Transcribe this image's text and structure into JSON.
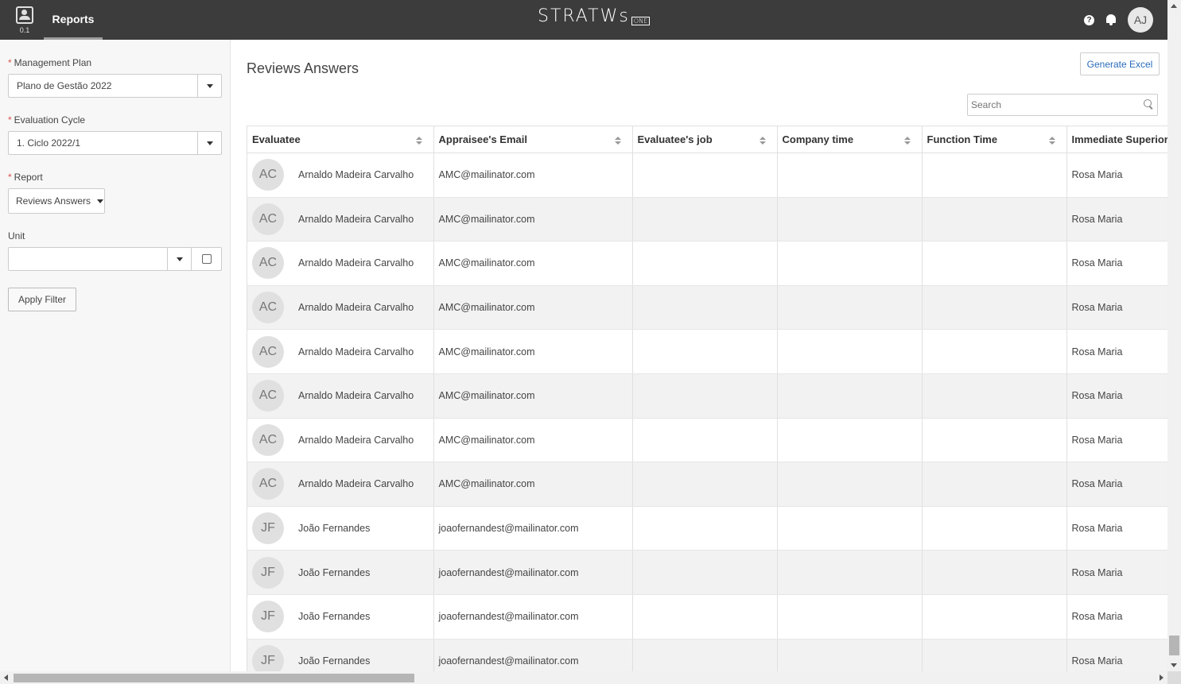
{
  "topbar": {
    "app_version": "0.1",
    "nav_label": "Reports",
    "logo_text": "STRATWs",
    "logo_suffix": "ONE",
    "help_glyph": "?",
    "user_initials": "AJ"
  },
  "sidebar": {
    "management_plan": {
      "label": "Management Plan",
      "required_mark": "*",
      "value": "Plano de Gestão 2022"
    },
    "evaluation_cycle": {
      "label": "Evaluation Cycle",
      "required_mark": "*",
      "value": "1. Ciclo 2022/1"
    },
    "report": {
      "label": "Report",
      "required_mark": "*",
      "value": "Reviews Answers"
    },
    "unit": {
      "label": "Unit",
      "value": ""
    },
    "apply_label": "Apply Filter"
  },
  "main": {
    "title": "Reviews Answers",
    "generate_label": "Generate Excel",
    "search_placeholder": "Search",
    "columns": [
      "Evaluatee",
      "Appraisee's Email",
      "Evaluatee's job",
      "Company time",
      "Function Time",
      "Immediate Superior"
    ],
    "rows": [
      {
        "initials": "AC",
        "name": "Arnaldo Madeira Carvalho",
        "email": "AMC@mailinator.com",
        "job": "",
        "company_time": "",
        "function_time": "",
        "superior": "Rosa Maria"
      },
      {
        "initials": "AC",
        "name": "Arnaldo Madeira Carvalho",
        "email": "AMC@mailinator.com",
        "job": "",
        "company_time": "",
        "function_time": "",
        "superior": "Rosa Maria"
      },
      {
        "initials": "AC",
        "name": "Arnaldo Madeira Carvalho",
        "email": "AMC@mailinator.com",
        "job": "",
        "company_time": "",
        "function_time": "",
        "superior": "Rosa Maria"
      },
      {
        "initials": "AC",
        "name": "Arnaldo Madeira Carvalho",
        "email": "AMC@mailinator.com",
        "job": "",
        "company_time": "",
        "function_time": "",
        "superior": "Rosa Maria"
      },
      {
        "initials": "AC",
        "name": "Arnaldo Madeira Carvalho",
        "email": "AMC@mailinator.com",
        "job": "",
        "company_time": "",
        "function_time": "",
        "superior": "Rosa Maria"
      },
      {
        "initials": "AC",
        "name": "Arnaldo Madeira Carvalho",
        "email": "AMC@mailinator.com",
        "job": "",
        "company_time": "",
        "function_time": "",
        "superior": "Rosa Maria"
      },
      {
        "initials": "AC",
        "name": "Arnaldo Madeira Carvalho",
        "email": "AMC@mailinator.com",
        "job": "",
        "company_time": "",
        "function_time": "",
        "superior": "Rosa Maria"
      },
      {
        "initials": "AC",
        "name": "Arnaldo Madeira Carvalho",
        "email": "AMC@mailinator.com",
        "job": "",
        "company_time": "",
        "function_time": "",
        "superior": "Rosa Maria"
      },
      {
        "initials": "JF",
        "name": "João Fernandes",
        "email": "joaofernandest@mailinator.com",
        "job": "",
        "company_time": "",
        "function_time": "",
        "superior": "Rosa Maria"
      },
      {
        "initials": "JF",
        "name": "João Fernandes",
        "email": "joaofernandest@mailinator.com",
        "job": "",
        "company_time": "",
        "function_time": "",
        "superior": "Rosa Maria"
      },
      {
        "initials": "JF",
        "name": "João Fernandes",
        "email": "joaofernandest@mailinator.com",
        "job": "",
        "company_time": "",
        "function_time": "",
        "superior": "Rosa Maria"
      },
      {
        "initials": "JF",
        "name": "João Fernandes",
        "email": "joaofernandest@mailinator.com",
        "job": "",
        "company_time": "",
        "function_time": "",
        "superior": "Rosa Maria"
      }
    ]
  },
  "colors": {
    "topbar_bg": "#3c3c3c",
    "accent_link": "#2a6dbb",
    "required": "#d9534f"
  }
}
